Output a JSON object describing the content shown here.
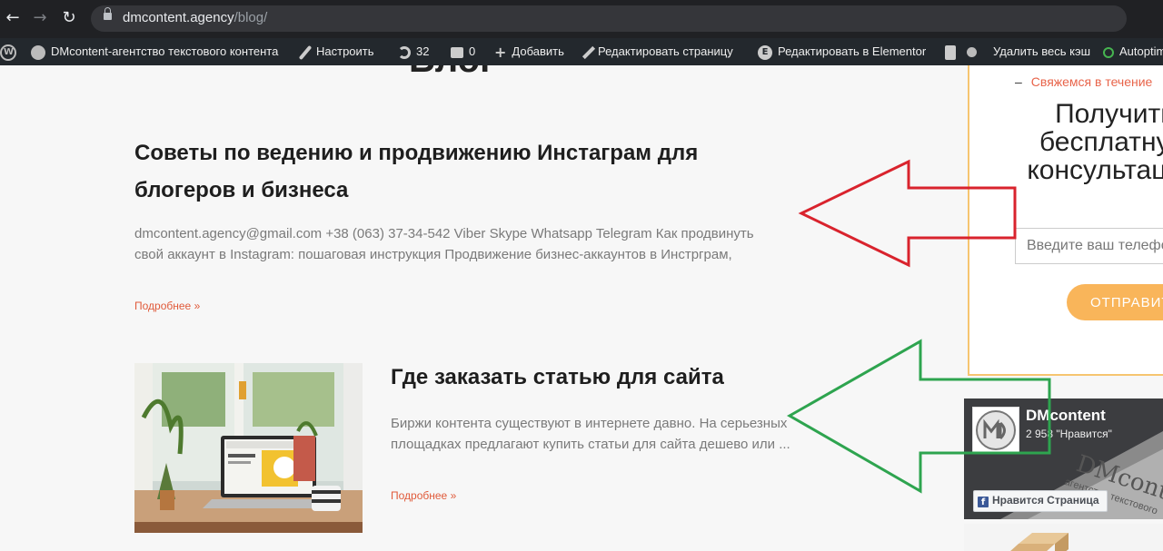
{
  "browser": {
    "url_host": "dmcontent.agency",
    "url_path": "/blog/",
    "back_icon": "←",
    "forward_icon": "→",
    "reload_icon": "↻"
  },
  "admin_bar": {
    "site_name": "DMcontent-агентство текстового контента",
    "customize": "Настроить",
    "updates_count": "32",
    "comments_count": "0",
    "add_new": "Добавить",
    "edit_page": "Редактировать страницу",
    "edit_elementor": "Редактировать в Elementor",
    "clear_cache": "Удалить весь кэш",
    "autoptimize": "Autoptimize",
    "elementor_glyph": "E",
    "plus_glyph": "+"
  },
  "page": {
    "title": "Блог"
  },
  "posts": [
    {
      "title": "Советы по ведению и продвижению Инстаграм для блогеров и бизнеса",
      "excerpt": "dmcontent.agency@gmail.com +38 (063) 37-34-542 Viber Skype Whatsapp Telegram Как продвинуть свой аккаунт в Instagram: пошаговая инструкция Продвижение бизнес-аккаунтов в Инстрграм,",
      "read_more": "Подробнее »"
    },
    {
      "title": "Где заказать статью для сайта",
      "excerpt": "Биржи контента существуют в интернете давно. На серьезных площадках предлагают купить статьи для сайта дешево или ...",
      "read_more": "Подробнее »"
    }
  ],
  "sidebar": {
    "contact_line": "Свяжемся в течение",
    "form_title": "Получить бесплатную консультацию",
    "phone_placeholder": "Введите ваш телефон",
    "send_button": "ОТПРАВИТЬ",
    "fb_page_name": "DMcontent",
    "fb_likes": "2 958 \"Нравится\"",
    "fb_like_button": "Нравится Страница",
    "fb_f_glyph": "f",
    "fb_cover_text": "DMcontent",
    "fb_cover_subtext": "агентство текстового"
  },
  "colors": {
    "accent": "#e05a3a",
    "form_border": "#f6c570",
    "button": "#f9b55a",
    "arrow_red": "#d9232d",
    "arrow_green": "#2ea44f"
  }
}
